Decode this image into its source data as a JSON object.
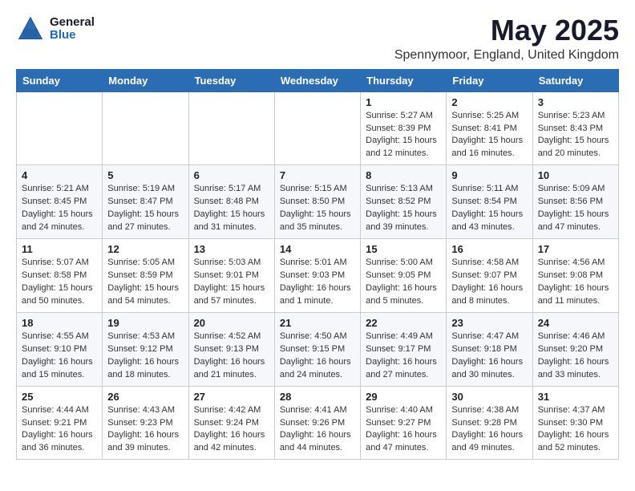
{
  "logo": {
    "general": "General",
    "blue": "Blue"
  },
  "header": {
    "title": "May 2025",
    "subtitle": "Spennymoor, England, United Kingdom"
  },
  "weekdays": [
    "Sunday",
    "Monday",
    "Tuesday",
    "Wednesday",
    "Thursday",
    "Friday",
    "Saturday"
  ],
  "weeks": [
    [
      {
        "day": "",
        "info": ""
      },
      {
        "day": "",
        "info": ""
      },
      {
        "day": "",
        "info": ""
      },
      {
        "day": "",
        "info": ""
      },
      {
        "day": "1",
        "info": "Sunrise: 5:27 AM\nSunset: 8:39 PM\nDaylight: 15 hours\nand 12 minutes."
      },
      {
        "day": "2",
        "info": "Sunrise: 5:25 AM\nSunset: 8:41 PM\nDaylight: 15 hours\nand 16 minutes."
      },
      {
        "day": "3",
        "info": "Sunrise: 5:23 AM\nSunset: 8:43 PM\nDaylight: 15 hours\nand 20 minutes."
      }
    ],
    [
      {
        "day": "4",
        "info": "Sunrise: 5:21 AM\nSunset: 8:45 PM\nDaylight: 15 hours\nand 24 minutes."
      },
      {
        "day": "5",
        "info": "Sunrise: 5:19 AM\nSunset: 8:47 PM\nDaylight: 15 hours\nand 27 minutes."
      },
      {
        "day": "6",
        "info": "Sunrise: 5:17 AM\nSunset: 8:48 PM\nDaylight: 15 hours\nand 31 minutes."
      },
      {
        "day": "7",
        "info": "Sunrise: 5:15 AM\nSunset: 8:50 PM\nDaylight: 15 hours\nand 35 minutes."
      },
      {
        "day": "8",
        "info": "Sunrise: 5:13 AM\nSunset: 8:52 PM\nDaylight: 15 hours\nand 39 minutes."
      },
      {
        "day": "9",
        "info": "Sunrise: 5:11 AM\nSunset: 8:54 PM\nDaylight: 15 hours\nand 43 minutes."
      },
      {
        "day": "10",
        "info": "Sunrise: 5:09 AM\nSunset: 8:56 PM\nDaylight: 15 hours\nand 47 minutes."
      }
    ],
    [
      {
        "day": "11",
        "info": "Sunrise: 5:07 AM\nSunset: 8:58 PM\nDaylight: 15 hours\nand 50 minutes."
      },
      {
        "day": "12",
        "info": "Sunrise: 5:05 AM\nSunset: 8:59 PM\nDaylight: 15 hours\nand 54 minutes."
      },
      {
        "day": "13",
        "info": "Sunrise: 5:03 AM\nSunset: 9:01 PM\nDaylight: 15 hours\nand 57 minutes."
      },
      {
        "day": "14",
        "info": "Sunrise: 5:01 AM\nSunset: 9:03 PM\nDaylight: 16 hours\nand 1 minute."
      },
      {
        "day": "15",
        "info": "Sunrise: 5:00 AM\nSunset: 9:05 PM\nDaylight: 16 hours\nand 5 minutes."
      },
      {
        "day": "16",
        "info": "Sunrise: 4:58 AM\nSunset: 9:07 PM\nDaylight: 16 hours\nand 8 minutes."
      },
      {
        "day": "17",
        "info": "Sunrise: 4:56 AM\nSunset: 9:08 PM\nDaylight: 16 hours\nand 11 minutes."
      }
    ],
    [
      {
        "day": "18",
        "info": "Sunrise: 4:55 AM\nSunset: 9:10 PM\nDaylight: 16 hours\nand 15 minutes."
      },
      {
        "day": "19",
        "info": "Sunrise: 4:53 AM\nSunset: 9:12 PM\nDaylight: 16 hours\nand 18 minutes."
      },
      {
        "day": "20",
        "info": "Sunrise: 4:52 AM\nSunset: 9:13 PM\nDaylight: 16 hours\nand 21 minutes."
      },
      {
        "day": "21",
        "info": "Sunrise: 4:50 AM\nSunset: 9:15 PM\nDaylight: 16 hours\nand 24 minutes."
      },
      {
        "day": "22",
        "info": "Sunrise: 4:49 AM\nSunset: 9:17 PM\nDaylight: 16 hours\nand 27 minutes."
      },
      {
        "day": "23",
        "info": "Sunrise: 4:47 AM\nSunset: 9:18 PM\nDaylight: 16 hours\nand 30 minutes."
      },
      {
        "day": "24",
        "info": "Sunrise: 4:46 AM\nSunset: 9:20 PM\nDaylight: 16 hours\nand 33 minutes."
      }
    ],
    [
      {
        "day": "25",
        "info": "Sunrise: 4:44 AM\nSunset: 9:21 PM\nDaylight: 16 hours\nand 36 minutes."
      },
      {
        "day": "26",
        "info": "Sunrise: 4:43 AM\nSunset: 9:23 PM\nDaylight: 16 hours\nand 39 minutes."
      },
      {
        "day": "27",
        "info": "Sunrise: 4:42 AM\nSunset: 9:24 PM\nDaylight: 16 hours\nand 42 minutes."
      },
      {
        "day": "28",
        "info": "Sunrise: 4:41 AM\nSunset: 9:26 PM\nDaylight: 16 hours\nand 44 minutes."
      },
      {
        "day": "29",
        "info": "Sunrise: 4:40 AM\nSunset: 9:27 PM\nDaylight: 16 hours\nand 47 minutes."
      },
      {
        "day": "30",
        "info": "Sunrise: 4:38 AM\nSunset: 9:28 PM\nDaylight: 16 hours\nand 49 minutes."
      },
      {
        "day": "31",
        "info": "Sunrise: 4:37 AM\nSunset: 9:30 PM\nDaylight: 16 hours\nand 52 minutes."
      }
    ]
  ]
}
